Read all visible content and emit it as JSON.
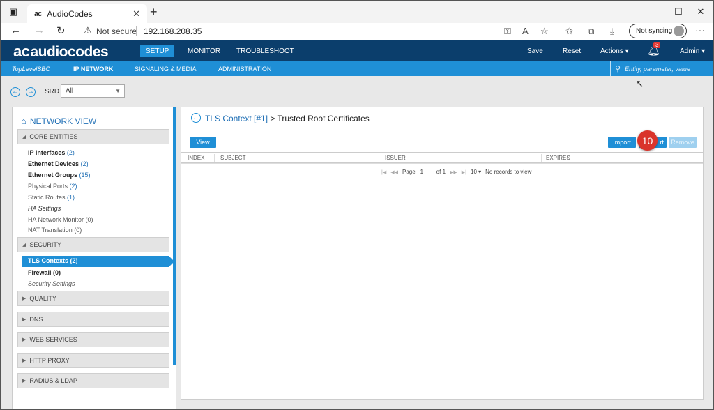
{
  "browser": {
    "tab_title": "AudioCodes",
    "tab_favicon": "ac",
    "address": {
      "security": "Not secure",
      "url": "192.168.208.35"
    },
    "sync_label": "Not syncing"
  },
  "app": {
    "logo_text": "audiocodes",
    "logo_mark": "ac",
    "main_tabs": [
      {
        "label": "SETUP",
        "active": true
      },
      {
        "label": "MONITOR",
        "active": false
      },
      {
        "label": "TROUBLESHOOT",
        "active": false
      }
    ],
    "header_actions": {
      "save": "Save",
      "reset": "Reset",
      "actions": "Actions ▾",
      "notifications": "3",
      "user": "Admin ▾"
    },
    "sub_header": {
      "device": "TopLevelSBC",
      "tabs": [
        {
          "label": "IP NETWORK",
          "active": true
        },
        {
          "label": "SIGNALING & MEDIA",
          "active": false
        },
        {
          "label": "ADMINISTRATION",
          "active": false
        }
      ],
      "search_placeholder": "Entity, parameter, value"
    },
    "srd": {
      "label": "SRD",
      "value": "All"
    },
    "network_view": {
      "title": "NETWORK VIEW",
      "sections": {
        "core": "CORE ENTITIES",
        "security": "SECURITY",
        "quality": "QUALITY",
        "dns": "DNS",
        "web": "WEB SERVICES",
        "http": "HTTP PROXY",
        "radius": "RADIUS & LDAP"
      },
      "core_items": {
        "ip_interfaces": {
          "label": "IP Interfaces",
          "count": "(2)"
        },
        "ethernet_devices": {
          "label": "Ethernet Devices",
          "count": "(2)"
        },
        "ethernet_groups": {
          "label": "Ethernet Groups",
          "count": "(15)"
        },
        "physical_ports": {
          "label": "Physical Ports",
          "count": "(2)"
        },
        "static_routes": {
          "label": "Static Routes",
          "count": "(1)"
        },
        "ha_settings": {
          "label": "HA Settings"
        },
        "ha_network_monitor": {
          "label": "HA Network Monitor (0)"
        },
        "nat_translation": {
          "label": "NAT Translation (0)"
        }
      },
      "security_items": {
        "tls_contexts": {
          "label": "TLS Contexts",
          "count": "(2)"
        },
        "firewall": {
          "label": "Firewall",
          "count": "(0)"
        },
        "security_settings": {
          "label": "Security Settings"
        }
      }
    },
    "panel": {
      "title_link": "TLS Context [#1]",
      "title_rest": " > Trusted Root Certificates",
      "buttons": {
        "view": "View",
        "import": "Import",
        "export_partial": "rt",
        "remove": "Remove"
      },
      "step_badge": "10",
      "columns": [
        "INDEX",
        "SUBJECT",
        "ISSUER",
        "EXPIRES"
      ],
      "pager": {
        "page_label": "Page",
        "page_num": "1",
        "of_label": "of 1",
        "page_size": "10 ▾",
        "empty_text": "No records to view"
      }
    }
  }
}
